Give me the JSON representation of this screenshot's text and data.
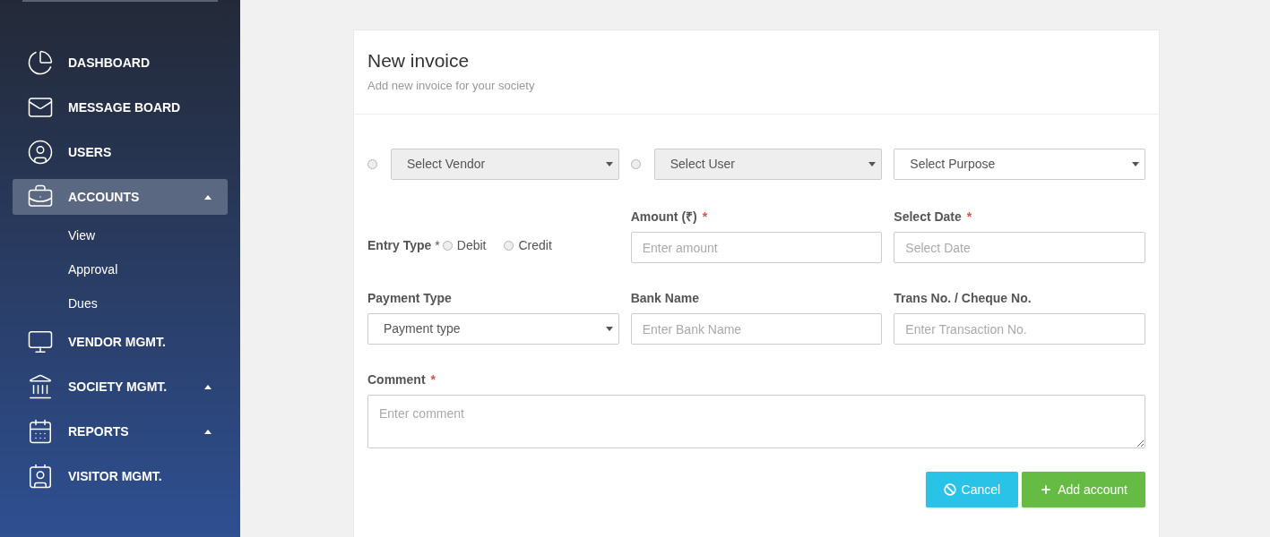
{
  "sidebar": {
    "items": [
      {
        "label": "DASHBOARD",
        "selected": false,
        "has_caret": false
      },
      {
        "label": "MESSAGE BOARD",
        "selected": false,
        "has_caret": false
      },
      {
        "label": "USERS",
        "selected": false,
        "has_caret": false
      },
      {
        "label": "ACCOUNTS",
        "selected": true,
        "has_caret": true,
        "children": [
          {
            "label": "View"
          },
          {
            "label": "Approval"
          },
          {
            "label": "Dues"
          }
        ]
      },
      {
        "label": "VENDOR MGMT.",
        "selected": false,
        "has_caret": false
      },
      {
        "label": "SOCIETY MGMT.",
        "selected": false,
        "has_caret": true
      },
      {
        "label": "REPORTS",
        "selected": false,
        "has_caret": true
      },
      {
        "label": "VISITOR MGMT.",
        "selected": false,
        "has_caret": false
      }
    ]
  },
  "card": {
    "title": "New invoice",
    "subtitle": "Add new invoice for your society",
    "party_selects": [
      {
        "radio": {
          "checked": false
        },
        "value": "Select Vendor",
        "disabled": true
      },
      {
        "radio": {
          "checked": false
        },
        "value": "Select User",
        "disabled": true
      },
      {
        "value": "Select Purpose",
        "disabled": false
      }
    ],
    "entry_type": {
      "label": "Entry Type",
      "required_mark": "*",
      "options": [
        {
          "label": "Debit",
          "selected": false
        },
        {
          "label": "Credit",
          "selected": false
        }
      ]
    },
    "fields": [
      {
        "kind": "input",
        "label": "Amount (₹)",
        "required_mark": "*",
        "placeholder": "Enter amount"
      },
      {
        "kind": "input",
        "label": "Select Date",
        "required_mark": "*",
        "placeholder": "Select Date"
      },
      {
        "kind": "select",
        "label": "Payment Type",
        "value": "Payment type"
      },
      {
        "kind": "input",
        "label": "Bank Name",
        "placeholder": "Enter Bank Name"
      },
      {
        "kind": "input",
        "label": "Trans No. / Cheque No.",
        "placeholder": "Enter Transaction No."
      }
    ],
    "comment": {
      "label": "Comment",
      "required_mark": "*",
      "placeholder": "Enter comment"
    },
    "buttons": [
      {
        "kind": "cancel",
        "label": "Cancel"
      },
      {
        "kind": "add",
        "label": "Add account"
      }
    ]
  }
}
